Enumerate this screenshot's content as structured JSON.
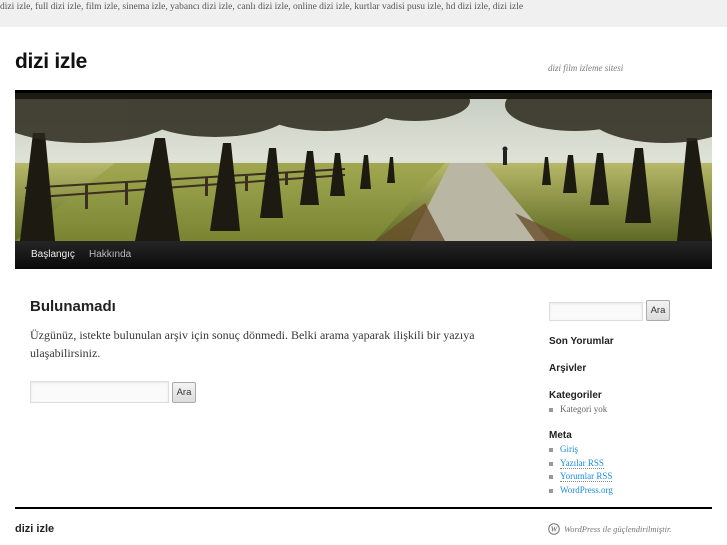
{
  "topbar": {
    "text": "dizi izle, full dizi izle, film izle, sinema izle, yabancı dizi izle, canlı dizi izle, online dizi izle, kurtlar vadisi pusu izle, hd dizi izle, dizi izle"
  },
  "site": {
    "title": "dizi izle",
    "description": "dizi film izleme sitesi"
  },
  "nav": {
    "items": [
      "Başlangıç",
      "Hakkında"
    ]
  },
  "content": {
    "title": "Bulunamadı",
    "text": "Üzgünüz, istekte bulunulan arşiv için sonuç dönmedi. Belki arama yaparak ilişkili bir yazıya ulaşabilirsiniz.",
    "search": {
      "button": "Ara",
      "value": ""
    }
  },
  "sidebar": {
    "search": {
      "button": "Ara",
      "value": ""
    },
    "widgets": {
      "recent_comments": "Son Yorumlar",
      "archives": "Arşivler",
      "categories": {
        "title": "Kategoriler",
        "items": [
          "Kategori yok"
        ]
      },
      "meta": {
        "title": "Meta",
        "items": [
          "Giriş",
          "Yazılar RSS",
          "Yorumlar RSS",
          "WordPress.org"
        ]
      }
    }
  },
  "footer": {
    "title": "dizi izle",
    "credit": "WordPress ile güçlendirilmiştir."
  },
  "colors": {
    "link": "#1b8be0",
    "nav_bg": "#111111",
    "topbar_bg": "#f0f0f0"
  }
}
